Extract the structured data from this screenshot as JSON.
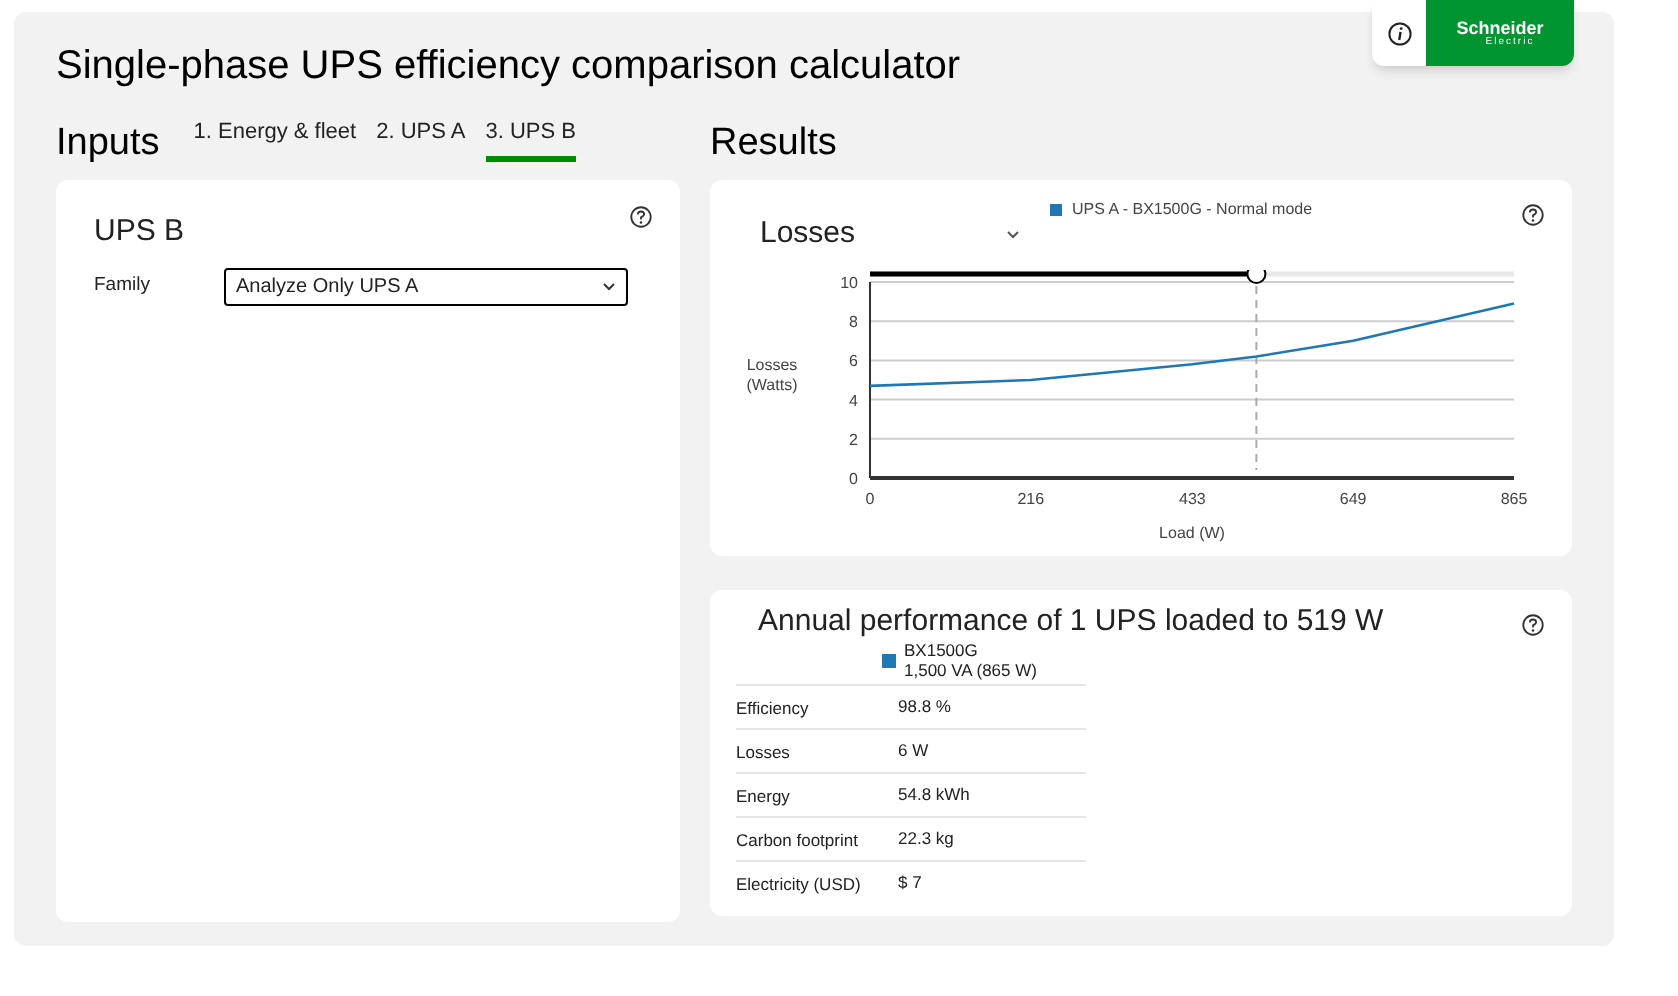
{
  "title": "Single-phase UPS efficiency comparison calculator",
  "logo": {
    "name": "Schneider",
    "sub": "Electric"
  },
  "inputs": {
    "heading": "Inputs",
    "tabs": [
      {
        "label": "1. Energy & fleet",
        "selected": false
      },
      {
        "label": "2. UPS A",
        "selected": false
      },
      {
        "label": "3. UPS B",
        "selected": true
      }
    ],
    "card": {
      "title": "UPS B",
      "fields": [
        {
          "label": "Family",
          "value": "Analyze Only UPS A"
        }
      ]
    }
  },
  "results": {
    "heading": "Results",
    "chart_card": {
      "selector": "Losses",
      "slider": {
        "level": 0.6
      },
      "chart_data": {
        "type": "line",
        "xlabel": "Load (W)",
        "ylabel": "Losses (Watts)",
        "x": [
          0,
          216,
          433,
          519,
          649,
          865
        ],
        "series": [
          {
            "name": "UPS A - BX1500G - Normal mode",
            "color": "#1f77b4",
            "values": [
              4.7,
              5.0,
              5.8,
              6.2,
              7.0,
              8.9
            ]
          }
        ],
        "grid": true,
        "ref_lines": [
          {
            "axis": "x",
            "value": 519
          }
        ],
        "xlim": [
          0,
          865
        ],
        "ylim": [
          0,
          10
        ],
        "xticks": [
          0,
          216,
          433,
          649,
          865
        ],
        "yticks": [
          0,
          2,
          4,
          6,
          8,
          10
        ]
      }
    },
    "performance": {
      "title": "Annual performance of 1 UPS loaded to 519 W",
      "model": {
        "name": "BX1500G",
        "rating": "1,500 VA (865 W)",
        "color": "#1f77b4"
      },
      "rows": [
        {
          "label": "Efficiency",
          "value": "98.8 %"
        },
        {
          "label": "Losses",
          "value": "6 W"
        },
        {
          "label": "Energy",
          "value": "54.8 kWh"
        },
        {
          "label": "Carbon footprint",
          "value": "22.3 kg"
        },
        {
          "label": "Electricity (USD)",
          "value": "$ 7"
        }
      ]
    }
  }
}
